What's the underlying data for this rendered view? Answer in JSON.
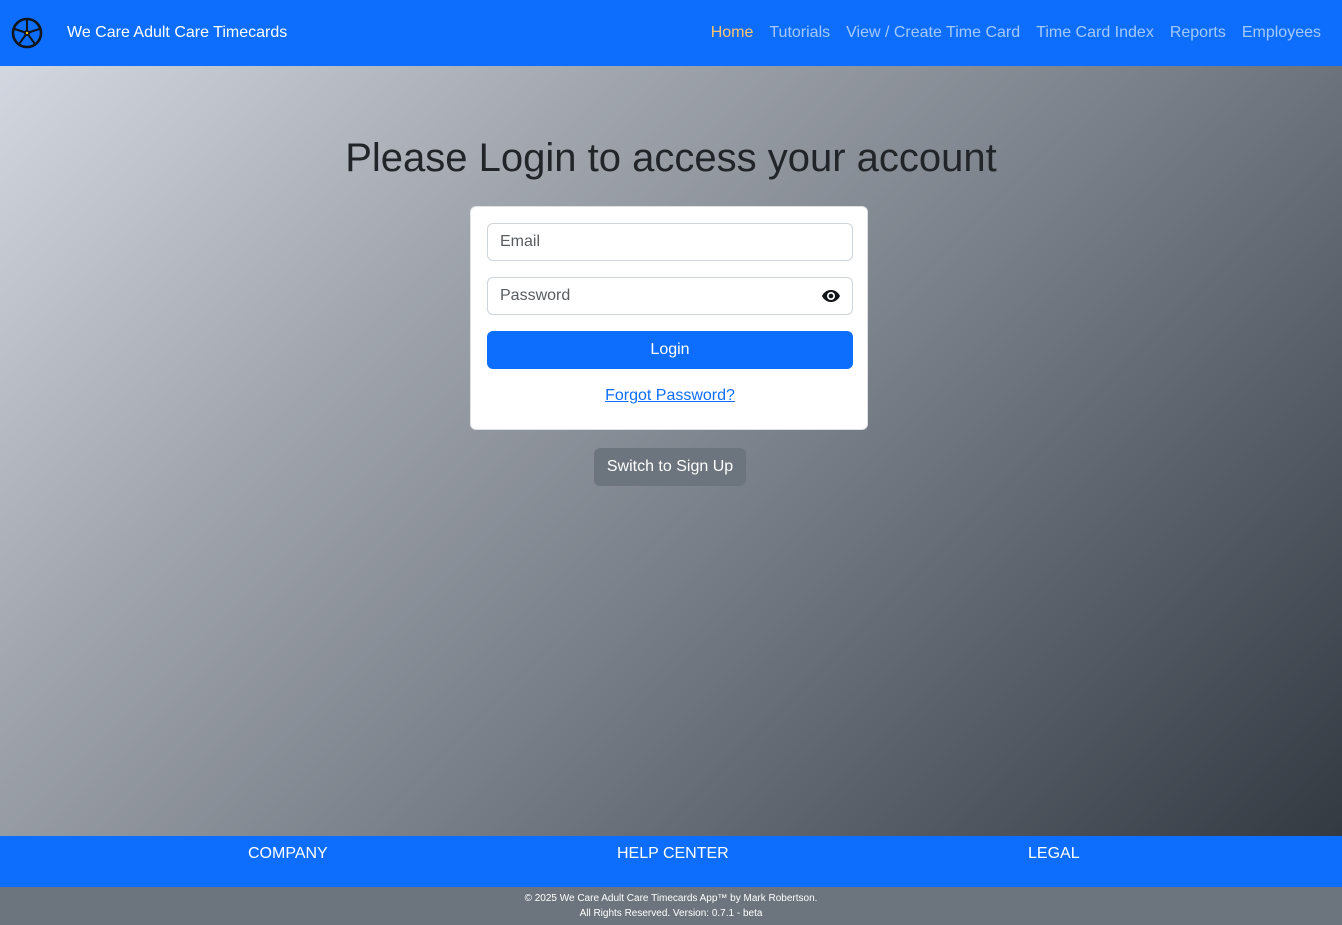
{
  "header": {
    "brand": "We Care Adult Care Timecards",
    "logo_icon": "wheelchair-wheel-icon",
    "nav": [
      {
        "label": "Home",
        "active": true
      },
      {
        "label": "Tutorials",
        "active": false
      },
      {
        "label": "View / Create Time Card",
        "active": false
      },
      {
        "label": "Time Card Index",
        "active": false
      },
      {
        "label": "Reports",
        "active": false
      },
      {
        "label": "Employees",
        "active": false
      }
    ]
  },
  "main": {
    "title": "Please Login to access your account",
    "login_form": {
      "email_placeholder": "Email",
      "email_value": "",
      "password_placeholder": "Password",
      "password_value": "",
      "password_toggle_icon": "eye-icon",
      "login_label": "Login",
      "forgot_label": "Forgot Password?"
    },
    "switch_label": "Switch to Sign Up"
  },
  "footer": {
    "headings": [
      "COMPANY",
      "HELP CENTER",
      "LEGAL"
    ],
    "copyright_line1": "© 2025 We Care Adult Care Timecards App™ by Mark Robertson.",
    "copyright_line2": "All Rights Reserved. Version: 0.7.1 - beta"
  },
  "colors": {
    "primary": "#0d6efd",
    "active_nav": "#ffc46b",
    "secondary": "#6c757d",
    "text_dark": "#212529"
  }
}
